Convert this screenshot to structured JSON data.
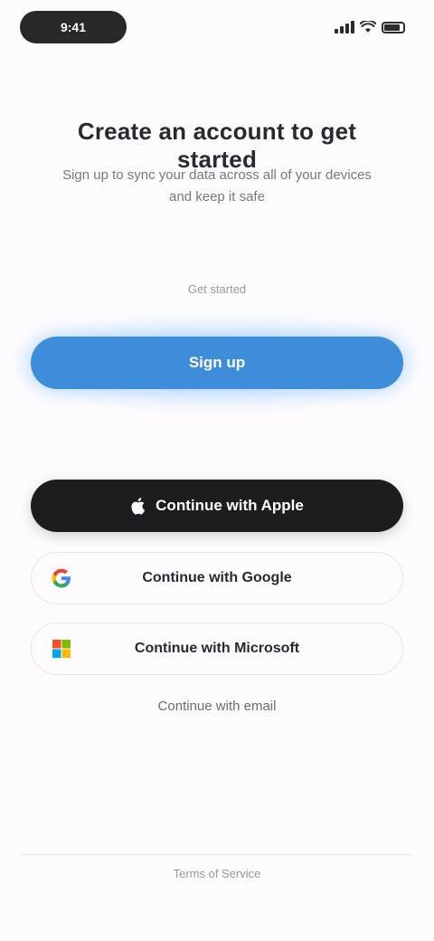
{
  "status_bar": {
    "time": "9:41"
  },
  "header": {
    "title": "Create an account to get started",
    "subtitle": "Sign up to sync your data across all of your devices and keep it safe"
  },
  "small_label": "Get started",
  "primary_button": {
    "label": "Sign up"
  },
  "providers": {
    "apple_label": "Continue with Apple",
    "google_label": "Continue with Google",
    "microsoft_label": "Continue with Microsoft"
  },
  "link_text": "Continue with email",
  "footer": {
    "text": "Terms of Service"
  },
  "colors": {
    "primary": "#3d8ddb",
    "apple": "#1f1c21",
    "background": "#fdfbfe"
  }
}
